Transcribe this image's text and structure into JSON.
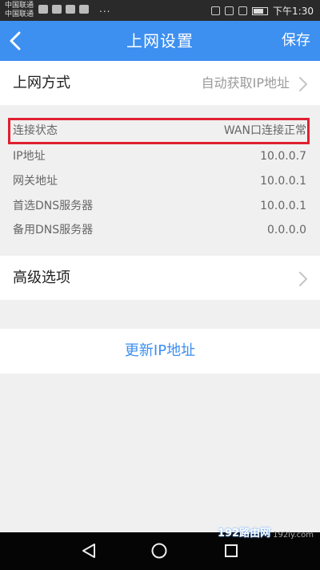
{
  "status_bar": {
    "carrier1": "中国联通",
    "carrier2": "中国联通",
    "ellipsis": "...",
    "time": "下午1:30"
  },
  "header": {
    "title": "上网设置",
    "save_label": "保存",
    "back_icon": "chevron-left-icon"
  },
  "wan": {
    "label": "上网方式",
    "value": "自动获取IP地址"
  },
  "info": {
    "status_label": "连接状态",
    "status_value": "WAN口连接正常",
    "ip_label": "IP地址",
    "ip_value": "10.0.0.7",
    "gateway_label": "网关地址",
    "gateway_value": "10.0.0.1",
    "dns1_label": "首选DNS服务器",
    "dns1_value": "10.0.0.1",
    "dns2_label": "备用DNS服务器",
    "dns2_value": "0.0.0.0"
  },
  "advanced": {
    "label": "高级选项"
  },
  "update": {
    "label": "更新IP地址"
  },
  "watermark": {
    "text": "192路由网",
    "sub": "192ly.com"
  },
  "colors": {
    "accent": "#3d8ff0",
    "highlight": "#e02030"
  }
}
